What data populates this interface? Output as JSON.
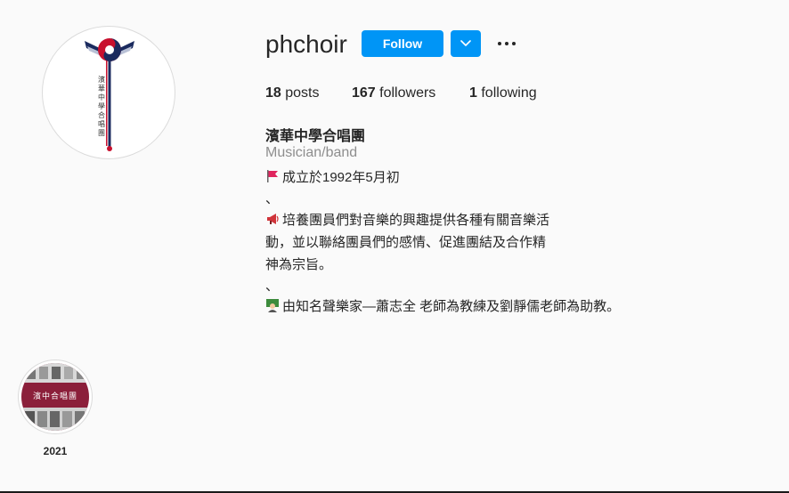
{
  "profile": {
    "username": "phchoir",
    "follow_label": "Follow",
    "stats": {
      "posts_count": "18",
      "posts_label": "posts",
      "followers_count": "167",
      "followers_label": "followers",
      "following_count": "1",
      "following_label": "following"
    },
    "bio": {
      "name": "濱華中學合唱團",
      "category": "Musician/band",
      "lines": [
        "成立於1992年5月初",
        "、",
        "培養團員們對音樂的興趣提供各種有關音樂活",
        "動，並以聯絡團員們的感情、促進團結及合作精",
        "神為宗旨。",
        "、",
        "由知名聲樂家—蕭志全 老師為教練及劉靜儒老師為助教。"
      ],
      "emoji_icons": [
        "red-flag-icon",
        "megaphone-icon",
        "teacher-icon"
      ]
    },
    "avatar": {
      "logo_text": "濱華中學合唱團"
    }
  },
  "highlights": [
    {
      "label": "2021",
      "cover_text": "濱中合唱團"
    }
  ],
  "colors": {
    "accent": "#0095f6",
    "text": "#262626",
    "secondary_text": "#8e8e8e",
    "background": "#fafafa"
  }
}
